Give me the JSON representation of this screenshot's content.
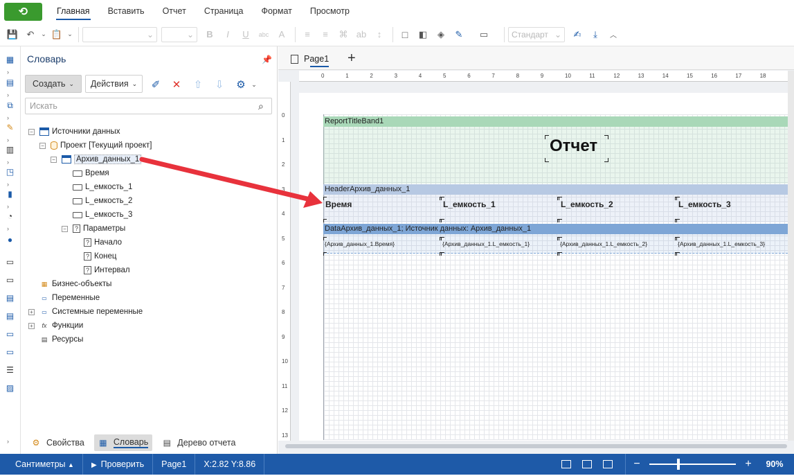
{
  "menubar": {
    "tabs": [
      "Главная",
      "Вставить",
      "Отчет",
      "Страница",
      "Формат",
      "Просмотр"
    ],
    "active": "Главная"
  },
  "toolbar": {
    "style_combo": "Стандарт"
  },
  "dictionary": {
    "title": "Словарь",
    "create_label": "Создать",
    "actions_label": "Действия",
    "search_placeholder": "Искать",
    "tree": {
      "data_sources": "Источники данных",
      "project": "Проект [Текущий проект]",
      "table": "Архив_данных_1",
      "columns": [
        "Время",
        "L_емкость_1",
        "L_емкость_2",
        "L_емкость_3"
      ],
      "parameters": "Параметры",
      "params": [
        "Начало",
        "Конец",
        "Интервал"
      ],
      "business_objects": "Бизнес-объекты",
      "variables": "Переменные",
      "system_variables": "Системные переменные",
      "functions": "Функции",
      "resources": "Ресурсы"
    },
    "bottom_tabs": [
      "Свойства",
      "Словарь",
      "Дерево отчета"
    ],
    "active_bottom_tab": "Словарь"
  },
  "designer": {
    "page_tab": "Page1",
    "hruler_labels": [
      "0",
      "1",
      "2",
      "3",
      "4",
      "5",
      "6",
      "7",
      "8",
      "9",
      "10",
      "11",
      "12",
      "13",
      "14",
      "15",
      "16",
      "17",
      "18"
    ],
    "vruler_labels": [
      "0",
      "1",
      "2",
      "3",
      "4",
      "5",
      "6",
      "7",
      "8",
      "9",
      "10",
      "11",
      "12",
      "13"
    ],
    "title_band": "ReportTitleBand1",
    "title_text": "Отчет",
    "header_band": "HeaderАрхив_данных_1",
    "header_cells": [
      "Время",
      "L_емкость_1",
      "L_емкость_2",
      "L_емкость_3"
    ],
    "data_band": "DataАрхив_данных_1; Источник данных: Архив_данных_1",
    "data_cells": [
      "{Архив_данных_1.Время}",
      "{Архив_данных_1.L_емкость_1}",
      "{Архив_данных_1.L_емкость_2}",
      "{Архив_данных_1.L_емкость_3}"
    ]
  },
  "statusbar": {
    "units": "Сантиметры",
    "check": "Проверить",
    "page": "Page1",
    "coords": "X:2.82 Y:8.86",
    "zoom": "90%"
  },
  "colors": {
    "accent": "#1e5aa8",
    "title_band": "#a9d8b8",
    "header_band": "#b7c9e3",
    "data_band": "#7ea6d6",
    "arrow": "#e8323c"
  }
}
